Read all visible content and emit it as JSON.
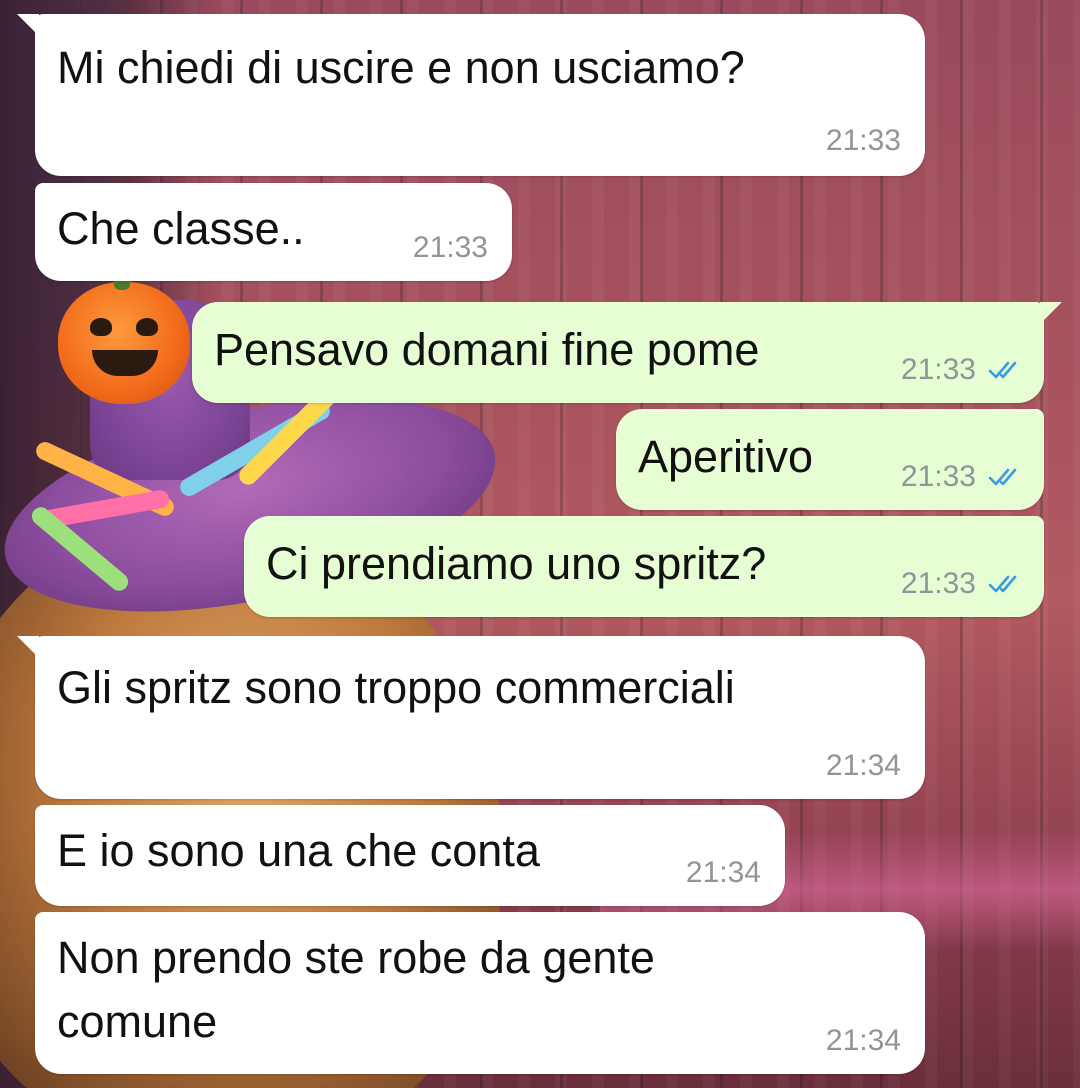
{
  "colors": {
    "incoming_bubble": "#ffffff",
    "outgoing_bubble": "#e7fdd3",
    "timestamp": "#8f9599",
    "read_ticks": "#3a9be0",
    "text": "#111111"
  },
  "messages": [
    {
      "direction": "in",
      "text": "Mi chiedi di uscire e non usciamo?",
      "time": "21:33"
    },
    {
      "direction": "in",
      "text": "Che classe..",
      "time": "21:33"
    },
    {
      "direction": "out",
      "text": "Pensavo domani fine pome",
      "time": "21:33",
      "status_icon": "double-check-read-icon"
    },
    {
      "direction": "out",
      "text": "Aperitivo",
      "time": "21:33",
      "status_icon": "double-check-read-icon"
    },
    {
      "direction": "out",
      "text": "Ci prendiamo uno spritz?",
      "time": "21:33",
      "status_icon": "double-check-read-icon"
    },
    {
      "direction": "in",
      "text": "Gli spritz sono troppo commerciali",
      "time": "21:34"
    },
    {
      "direction": "in",
      "text": "E io sono una che conta",
      "time": "21:34"
    },
    {
      "direction": "in",
      "text": "Non prendo ste robe da gente comune",
      "text_line_1": "Non prendo ste robe da gente",
      "text_line_2": "comune",
      "time": "21:34"
    }
  ]
}
